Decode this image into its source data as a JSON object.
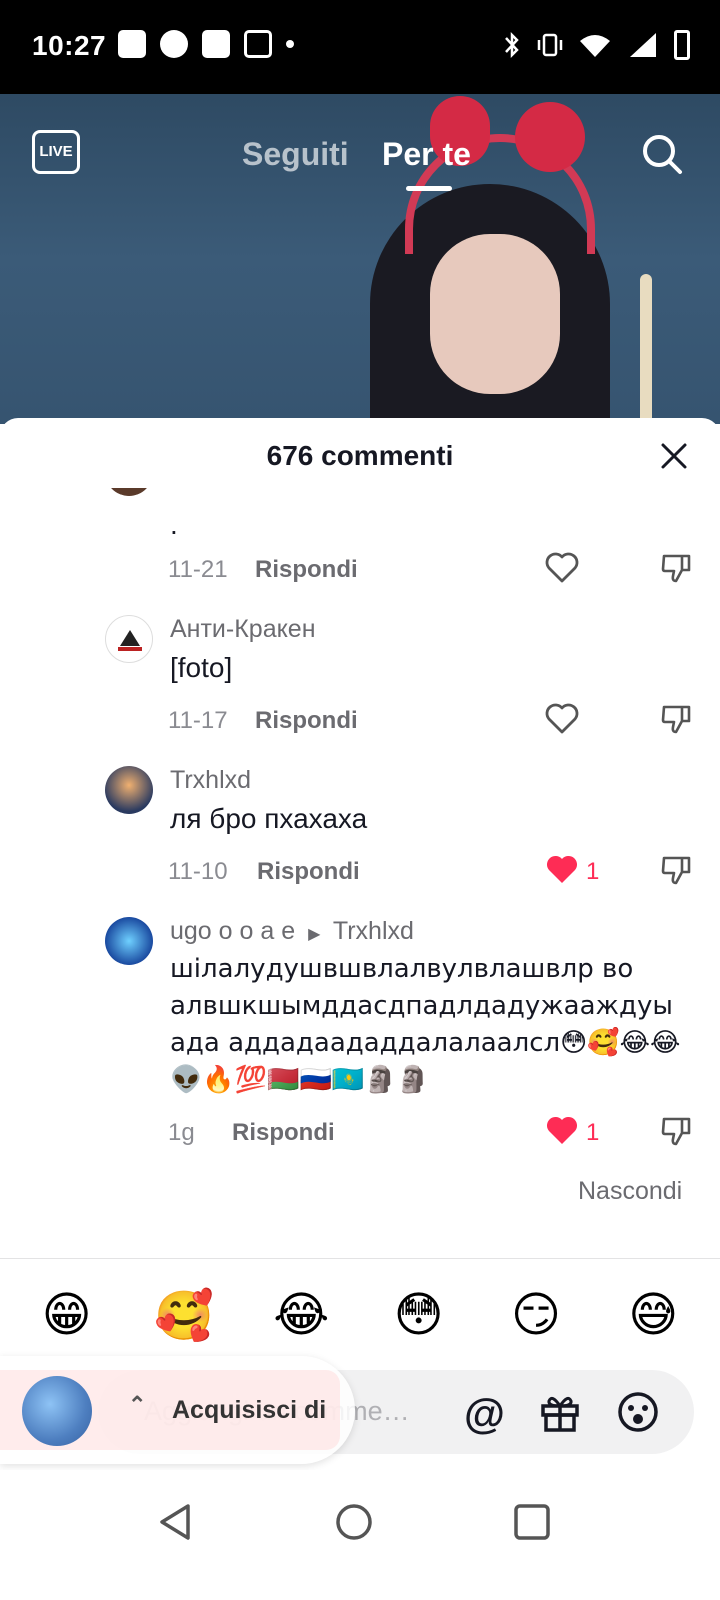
{
  "status_bar": {
    "time": "10:27"
  },
  "nav": {
    "live_label": "LIVE",
    "tab_following": "Seguiti",
    "tab_foryou": "Per te"
  },
  "sheet": {
    "title": "676 commenti"
  },
  "comments": [
    {
      "user": "",
      "text": ".",
      "date": "11-21",
      "reply": "Rispondi",
      "likes": ""
    },
    {
      "user": "Анти-Кракен",
      "text": " [foto]",
      "date": "11-17",
      "reply": "Rispondi",
      "likes": ""
    },
    {
      "user": "Trxhlxd",
      "text": "ля бро пхахаха",
      "date": "11-10",
      "reply": "Rispondi",
      "likes": "1"
    },
    {
      "user": "ugo o o a e",
      "reply_to": "Trxhlxd",
      "text": "шілалудушвшвлалвулвлашвлр во алвшкшымддасдпадлдадужааждуы ада аддадаададдалалаалсл😳🥰😂😂👽🔥💯🇧🇾🇷🇺🇰🇿🗿🗿",
      "date": "1g",
      "reply": "Rispondi",
      "likes": "1"
    }
  ],
  "hide_label": "Nascondi",
  "emoji_bar": [
    "😁",
    "🥰",
    "😂",
    "😳",
    "😏",
    "😅"
  ],
  "input": {
    "placeholder": "Aggiungi un comme…",
    "at_symbol": "@"
  },
  "capture": {
    "label": "Acquisisci di"
  },
  "colors": {
    "like": "#fe2c55",
    "text": "#161823",
    "muted": "#8a8b91"
  }
}
